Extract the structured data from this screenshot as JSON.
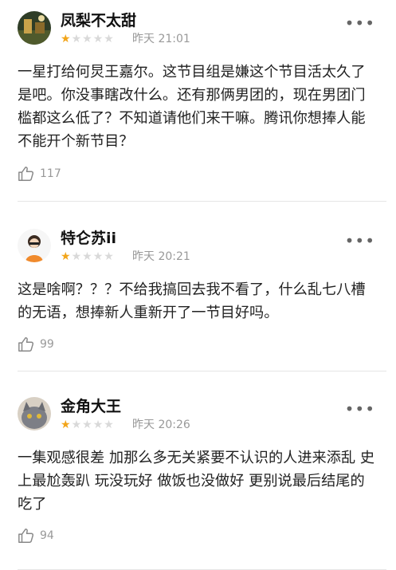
{
  "reviews": [
    {
      "username": "凤梨不太甜",
      "rating": 1,
      "max_rating": 5,
      "time": "昨天 21:01",
      "content": "一星打给何炅王嘉尔。这节目组是嫌这个节目活太久了是吧。你没事瞎改什么。还有那俩男团的，现在男团门槛都这么低了？不知道请他们来干嘛。腾讯你想捧人能不能开个新节目？",
      "likes": "117",
      "avatar_colors": [
        "#3a4a2e",
        "#c9a24a"
      ]
    },
    {
      "username": "特仑苏ii",
      "rating": 1,
      "max_rating": 5,
      "time": "昨天 20:21",
      "content": "这是啥啊？？？不给我搞回去我不看了，什么乱七八槽的无语，想捧新人重新开了一节目好吗。",
      "likes": "99",
      "avatar_colors": [
        "#f4f4f4",
        "#f08a2c"
      ]
    },
    {
      "username": "金角大王",
      "rating": 1,
      "max_rating": 5,
      "time": "昨天 20:26",
      "content": "一集观感很差 加那么多无关紧要不认识的人进来添乱 史上最尬轰趴 玩没玩好 做饭也没做好 更别说最后结尾的吃了",
      "likes": "94",
      "avatar_colors": [
        "#7d7f86",
        "#c3c5ca"
      ]
    }
  ],
  "more_label": "•••"
}
